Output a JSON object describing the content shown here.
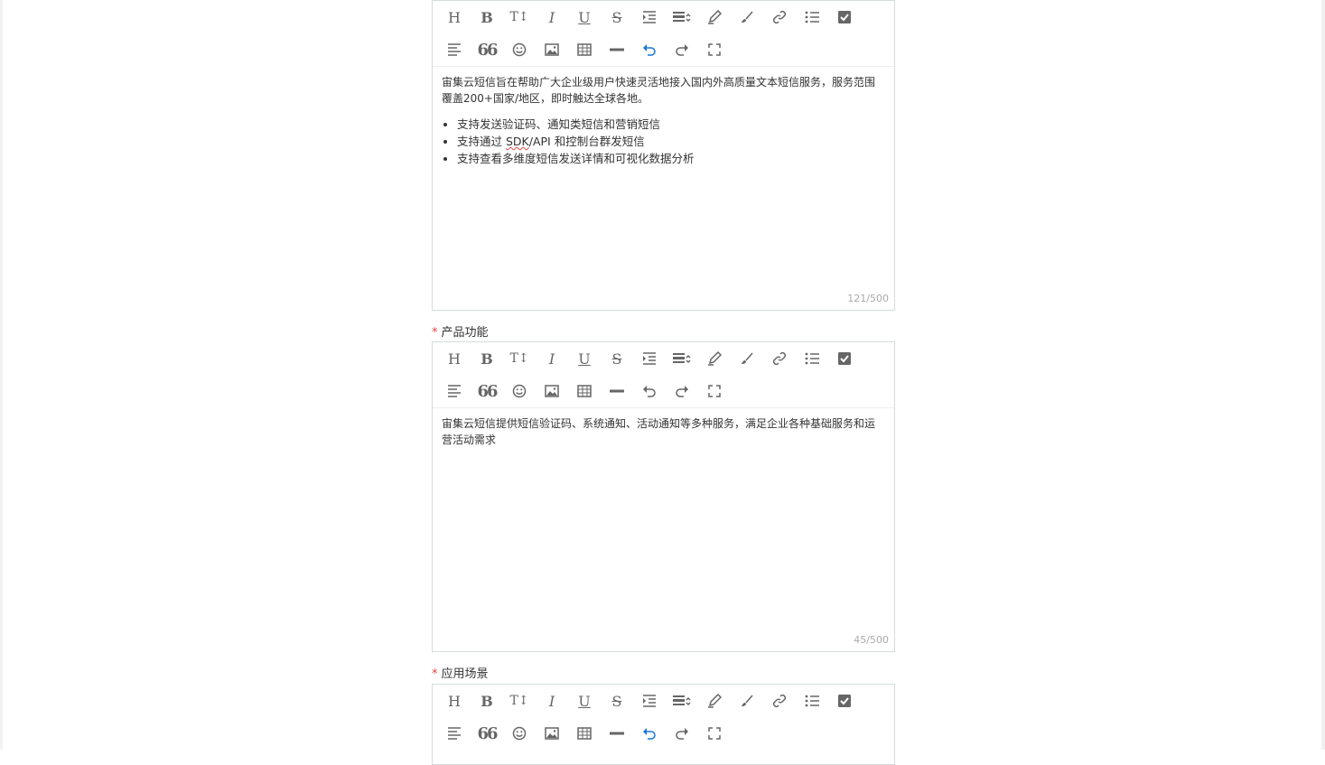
{
  "toolbar": {
    "heading_glyph": "H",
    "bold_glyph": "B",
    "font_size_glyph": "T↕",
    "italic_glyph": "I",
    "underline_glyph": "U",
    "strike_glyph": "S",
    "quote_glyph": "66",
    "icons_row1": [
      "heading-icon",
      "bold-icon",
      "font-size-icon",
      "italic-icon",
      "underline-icon",
      "strikethrough-icon",
      "indent-icon",
      "line-height-icon",
      "pen-color-icon",
      "brush-icon",
      "link-icon",
      "list-icon",
      "checkbox-icon"
    ],
    "icons_row2": [
      "align-icon",
      "quote-icon",
      "emoji-icon",
      "image-icon",
      "table-icon",
      "divider-icon",
      "undo-icon",
      "redo-icon",
      "fullscreen-icon"
    ]
  },
  "editor1": {
    "paragraph": "宙集云短信旨在帮助广大企业级用户快速灵活地接入国内外高质量文本短信服务，服务范围覆盖200+国家/地区，即时触达全球各地。",
    "bullets": [
      {
        "pre": "支持发送验证码、通知类短信和营销短信",
        "spell": "",
        "post": ""
      },
      {
        "pre": "支持通过 ",
        "spell": "SDK",
        "post": "/API 和控制台群发短信"
      },
      {
        "pre": "支持查看多维度短信发送详情和可视化数据分析",
        "spell": "",
        "post": ""
      }
    ],
    "counter": "121/500",
    "undo_active": true
  },
  "editor2": {
    "label": "产品功能",
    "paragraph": "宙集云短信提供短信验证码、系统通知、活动通知等多种服务，满足企业各种基础服务和运营活动需求",
    "counter": "45/500",
    "undo_active": false
  },
  "editor3": {
    "label": "应用场景",
    "undo_active": true
  },
  "required_mark": "*",
  "colors": {
    "accent": "#1677d9",
    "required": "#e8453c",
    "border": "#d6dcdc",
    "icon": "#666666"
  }
}
